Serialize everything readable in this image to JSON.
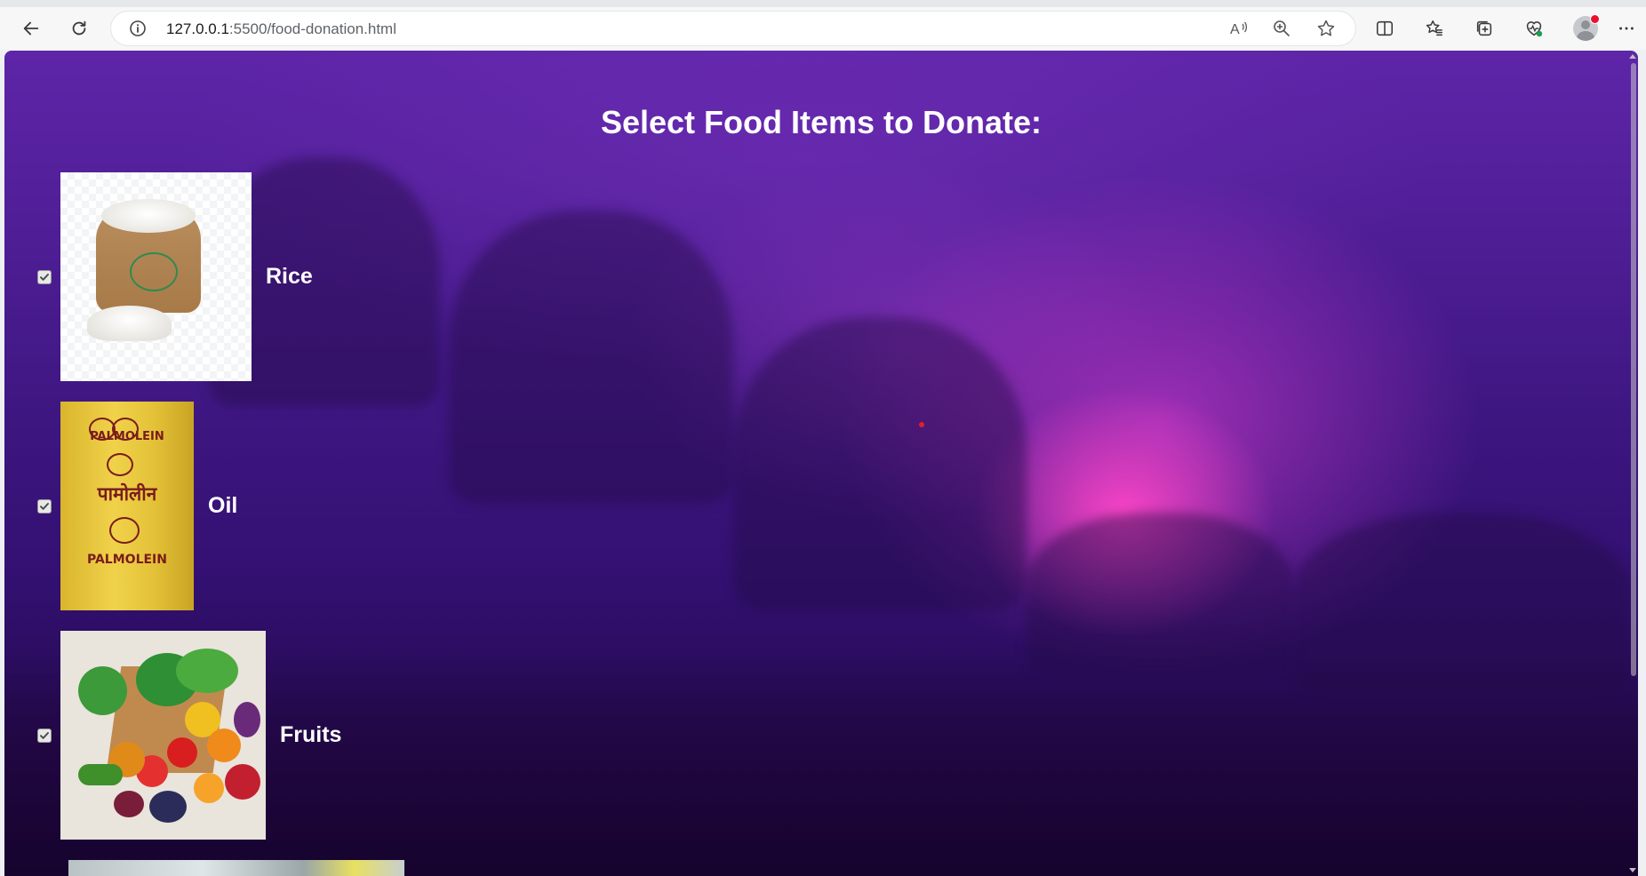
{
  "browser": {
    "url_host": "127.0.0.1",
    "url_rest": ":5500/food-donation.html"
  },
  "page": {
    "title": "Select Food Items to Donate:",
    "items": [
      {
        "label": "Rice",
        "checked": true,
        "image": "rice-sack"
      },
      {
        "label": "Oil",
        "checked": true,
        "image": "palmolein-oil-pack"
      },
      {
        "label": "Fruits",
        "checked": true,
        "image": "fruits-and-vegetables"
      }
    ],
    "oil_pack_text": {
      "top": "PALMOLEIN",
      "middle": "पामोलीन",
      "bottom": "PALMOLEIN"
    }
  },
  "icons": [
    "back-arrow-icon",
    "reload-icon",
    "info-icon",
    "read-aloud-icon",
    "zoom-icon",
    "favorite-star-icon",
    "split-screen-icon",
    "favorites-icon",
    "collections-icon",
    "browser-essentials-icon",
    "profile-avatar",
    "more-options-icon"
  ],
  "colors": {
    "title": "#ffffff",
    "background_top": "#5e25a8",
    "background_glow": "#ff46c8"
  }
}
